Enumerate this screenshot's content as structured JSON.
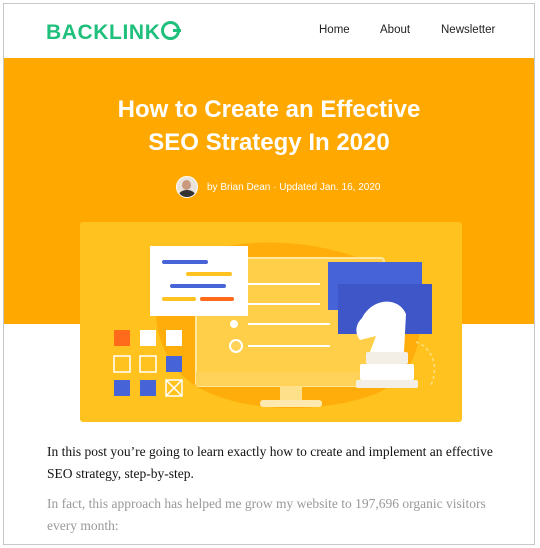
{
  "brand": {
    "name": "BACKLINK",
    "name_tail": "",
    "color": "#1fbf7c"
  },
  "nav": {
    "home": "Home",
    "about": "About",
    "newsletter": "Newsletter"
  },
  "hero": {
    "title_line1": "How to Create an Effective",
    "title_line2": "SEO Strategy In 2020",
    "byline": "by Brian Dean · Updated Jan. 16, 2020",
    "background": "#ffa800"
  },
  "article": {
    "paragraph1": "In this post you’re going to learn exactly how to create and implement an effective SEO strategy, step-by-step.",
    "paragraph2": "In fact, this approach has helped me grow my website to 197,696 organic visitors every month:"
  },
  "illustration": {
    "accent_blue": "#4763d8",
    "accent_orange": "#ff6b1a",
    "card_bg": "#ffc21e"
  }
}
